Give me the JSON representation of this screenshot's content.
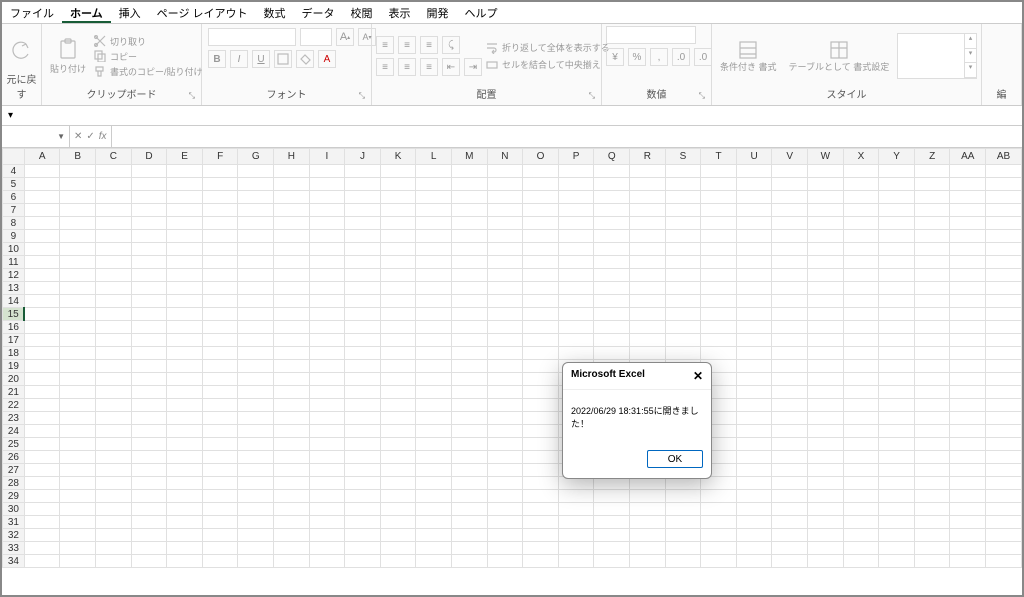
{
  "tabs": [
    "ファイル",
    "ホーム",
    "挿入",
    "ページ レイアウト",
    "数式",
    "データ",
    "校閲",
    "表示",
    "開発",
    "ヘルプ"
  ],
  "active_tab": 1,
  "ribbon": {
    "undo_label": "元に戻す",
    "clipboard_label": "クリップボード",
    "paste_label": "貼り付け",
    "cut": "切り取り",
    "copy": "コピー",
    "format_painter": "書式のコピー/貼り付け",
    "font_label": "フォント",
    "align_label": "配置",
    "wrap": "折り返して全体を表示する",
    "merge": "セルを結合して中央揃え",
    "number_label": "数値",
    "style_label": "スタイル",
    "cond_fmt": "条件付き\n書式",
    "table_fmt": "テーブルとして\n書式設定",
    "edit_label": "編"
  },
  "font_buttons": {
    "bold": "B",
    "italic": "I",
    "underline": "U",
    "grow": "A",
    "shrink": "A"
  },
  "formula": {
    "name_box": "",
    "fx": "fx"
  },
  "columns": [
    "A",
    "B",
    "C",
    "D",
    "E",
    "F",
    "G",
    "H",
    "I",
    "J",
    "K",
    "L",
    "M",
    "N",
    "O",
    "P",
    "Q",
    "R",
    "S",
    "T",
    "U",
    "V",
    "W",
    "X",
    "Y",
    "Z",
    "AA",
    "AB"
  ],
  "row_start": 4,
  "row_end": 34,
  "selected_row": 15,
  "dialog": {
    "title": "Microsoft Excel",
    "message": "2022/06/29 18:31:55に開きました！",
    "ok": "OK"
  }
}
